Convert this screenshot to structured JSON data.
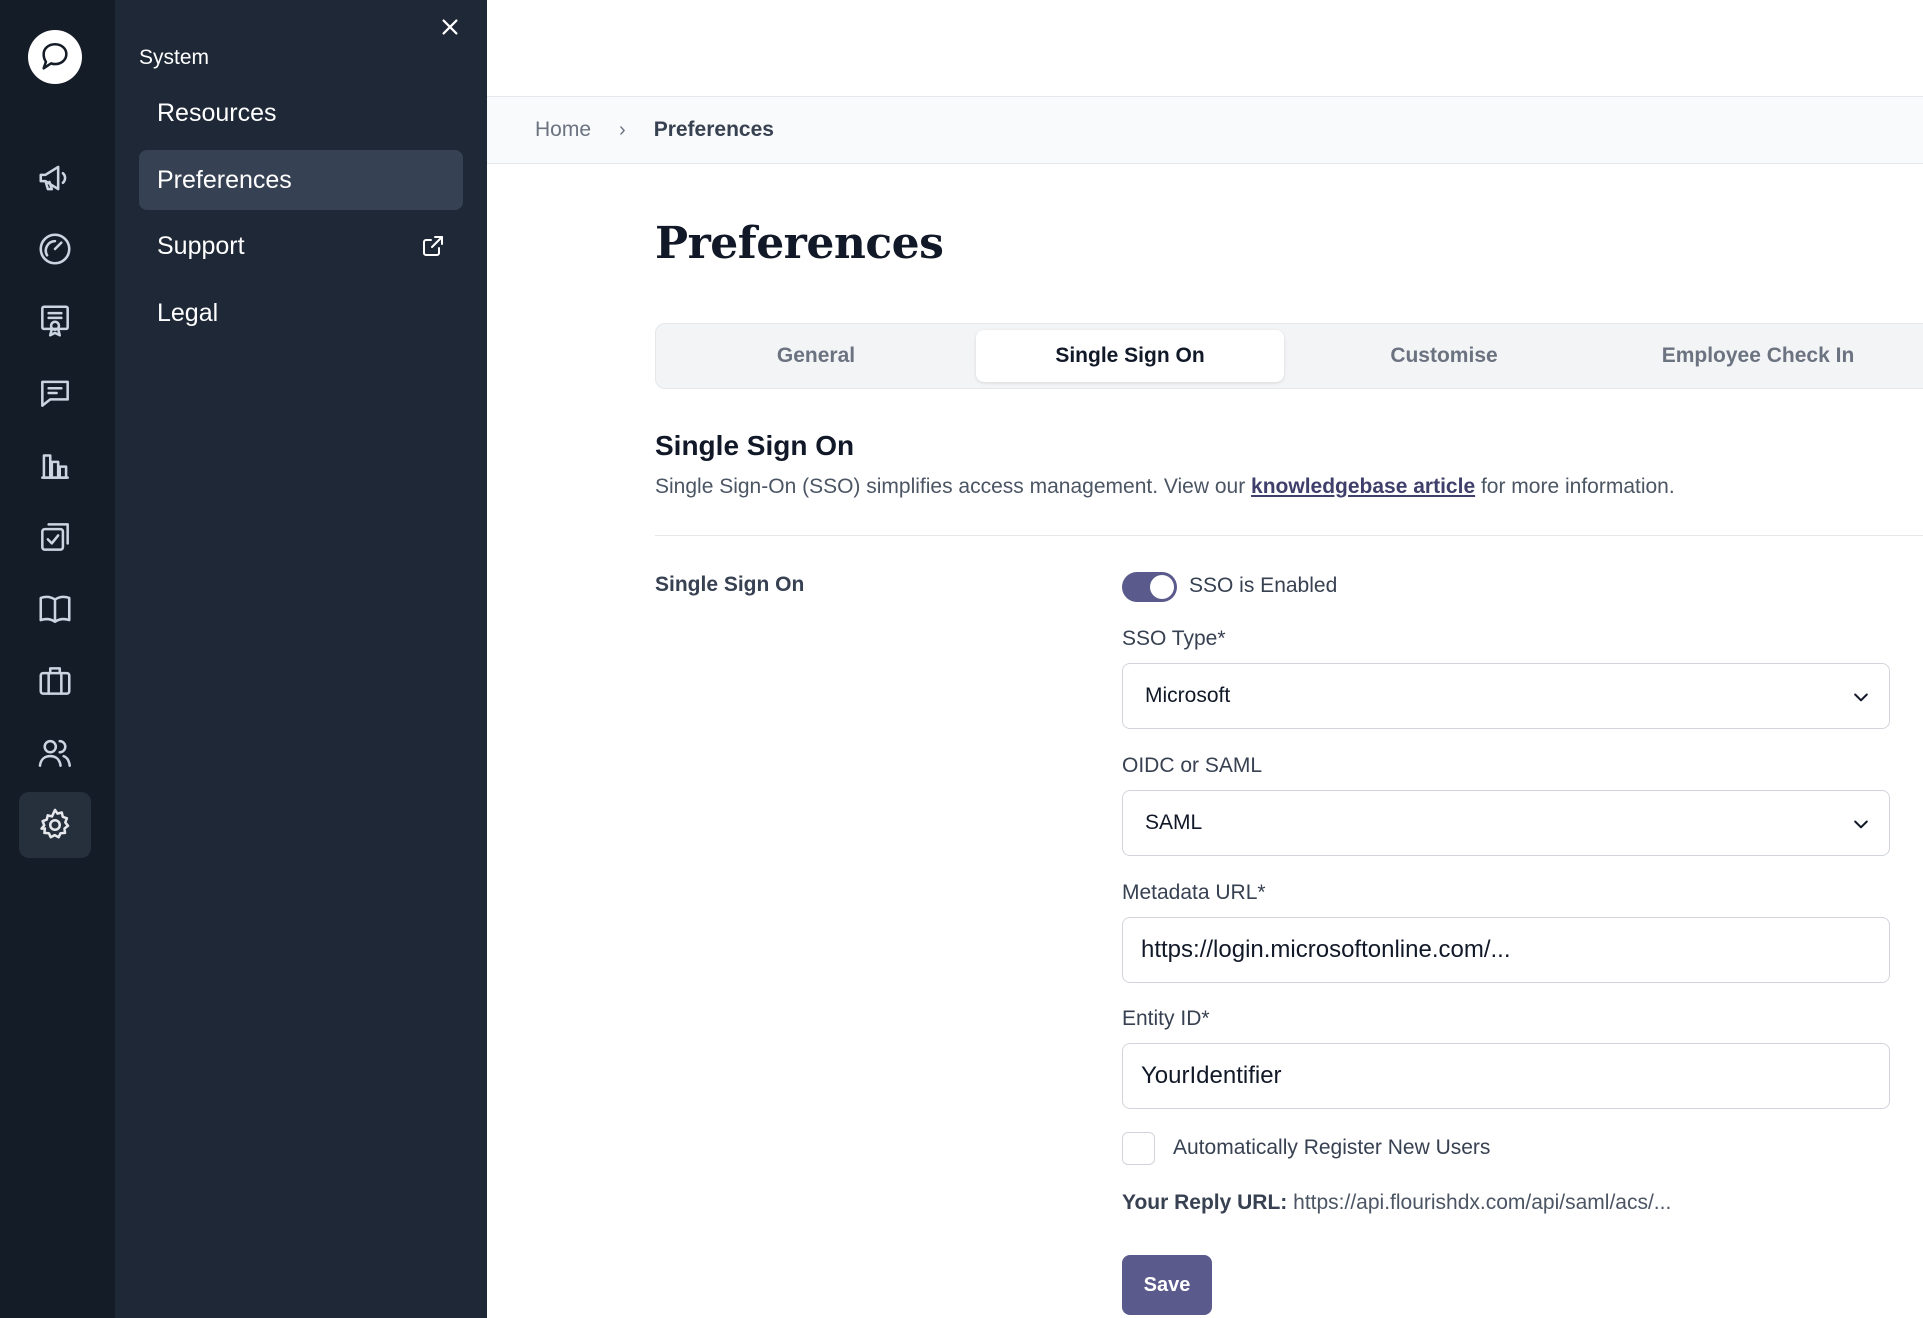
{
  "sidebar": {
    "icons": [
      {
        "name": "logo-icon"
      },
      {
        "name": "megaphone-icon"
      },
      {
        "name": "gauge-icon"
      },
      {
        "name": "certificate-icon"
      },
      {
        "name": "message-icon"
      },
      {
        "name": "chart-icon"
      },
      {
        "name": "checklist-icon"
      },
      {
        "name": "book-icon"
      },
      {
        "name": "briefcase-icon"
      },
      {
        "name": "users-icon"
      },
      {
        "name": "gear-icon"
      }
    ],
    "active": "gear-icon"
  },
  "submenu": {
    "heading": "System",
    "items": [
      {
        "label": "Resources"
      },
      {
        "label": "Preferences"
      },
      {
        "label": "Support"
      },
      {
        "label": "Legal"
      }
    ]
  },
  "breadcrumb": {
    "home": "Home",
    "separator": "›",
    "current": "Preferences"
  },
  "page": {
    "title": "Preferences"
  },
  "tabs": [
    {
      "label": "General"
    },
    {
      "label": "Single Sign On"
    },
    {
      "label": "Customise"
    },
    {
      "label": "Employee Check In"
    }
  ],
  "section": {
    "title": "Single Sign On",
    "desc_before": "Single Sign-On (SSO) simplifies access management. View our ",
    "link": "knowledgebase article",
    "desc_after": " for more information."
  },
  "form": {
    "row_label": "Single Sign On",
    "toggle_label": "SSO is Enabled",
    "sso_type_label": "SSO Type*",
    "sso_type_value": "Microsoft",
    "protocol_label": "OIDC or SAML",
    "protocol_value": "SAML",
    "metadata_label": "Metadata URL*",
    "metadata_value": "https://login.microsoftonline.com/...",
    "entity_label": "Entity ID*",
    "entity_value": "YourIdentifier",
    "auto_register_label": "Automatically Register New Users",
    "reply_label": "Your Reply URL:",
    "reply_value": "https://api.flourishdx.com/api/saml/acs/...",
    "save_label": "Save"
  },
  "colors": {
    "rail": "#141c27",
    "panel": "#1e2836",
    "accent": "#5a5a8c"
  }
}
